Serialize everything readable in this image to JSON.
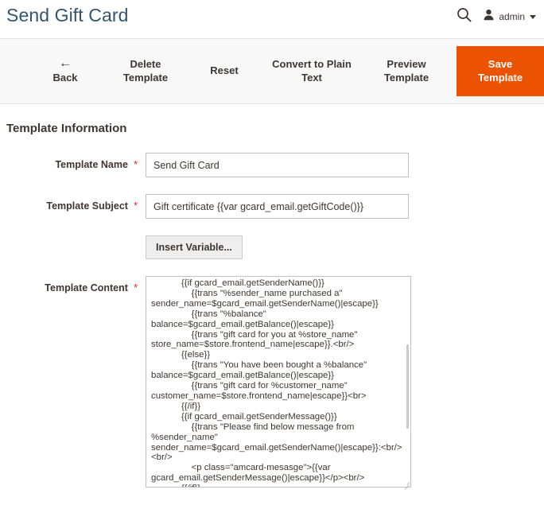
{
  "header": {
    "title": "Send Gift Card",
    "search_icon": "search-icon",
    "user_icon": "user-avatar-icon",
    "admin_label": "admin",
    "caret_icon": "chevron-down-icon"
  },
  "toolbar": {
    "back_arrow": "←",
    "back_label": "Back",
    "delete_label": "Delete\nTemplate",
    "reset_label": "Reset",
    "convert_label": "Convert to Plain\nText",
    "preview_label": "Preview\nTemplate",
    "save_label": "Save\nTemplate",
    "primary_color": "#eb5202",
    "background_color": "#f8f8f8"
  },
  "main": {
    "section_title": "Template Information",
    "required_marker": "*",
    "fields": {
      "template_name": {
        "label": "Template Name",
        "value": "Send Gift Card",
        "placeholder": ""
      },
      "template_subject": {
        "label": "Template Subject",
        "value": "Gift certificate {{var gcard_email.getGiftCode()}}",
        "placeholder": ""
      },
      "insert_variable": {
        "label": "Insert Variable..."
      },
      "template_content": {
        "label": "Template Content",
        "value": "            {{if gcard_email.getSenderName()}}\n                {{trans \"%sender_name purchased a\" sender_name=$gcard_email.getSenderName()|escape}}\n                {{trans \"%balance\" balance=$gcard_email.getBalance()|escape}}\n                {{trans \"gift card for you at %store_name\" store_name=$store.frontend_name|escape}}.<br/>\n            {{else}}\n                {{trans \"You have been bought a %balance\" balance=$gcard_email.getBalance()|escape}}\n                {{trans \"gift card for %customer_name\" customer_name=$store.frontend_name|escape}}<br>\n            {{/if}}\n            {{if gcard_email.getSenderMessage()}}\n                {{trans \"Please find below message from %sender_name\" sender_name=$gcard_email.getSenderName()|escape}}:<br/><br/>\n                <p class=\"amcard-mesasge\">{{var gcard_email.getSenderMessage()|escape}}</p><br/>\n            {{/if}}\n            {{trans \"Please use the following gift card code at"
      }
    }
  },
  "colors": {
    "accent": "#eb5202",
    "title": "#33556b",
    "text": "#41362f",
    "required": "#e02b27",
    "border": "#c2c2c2"
  }
}
